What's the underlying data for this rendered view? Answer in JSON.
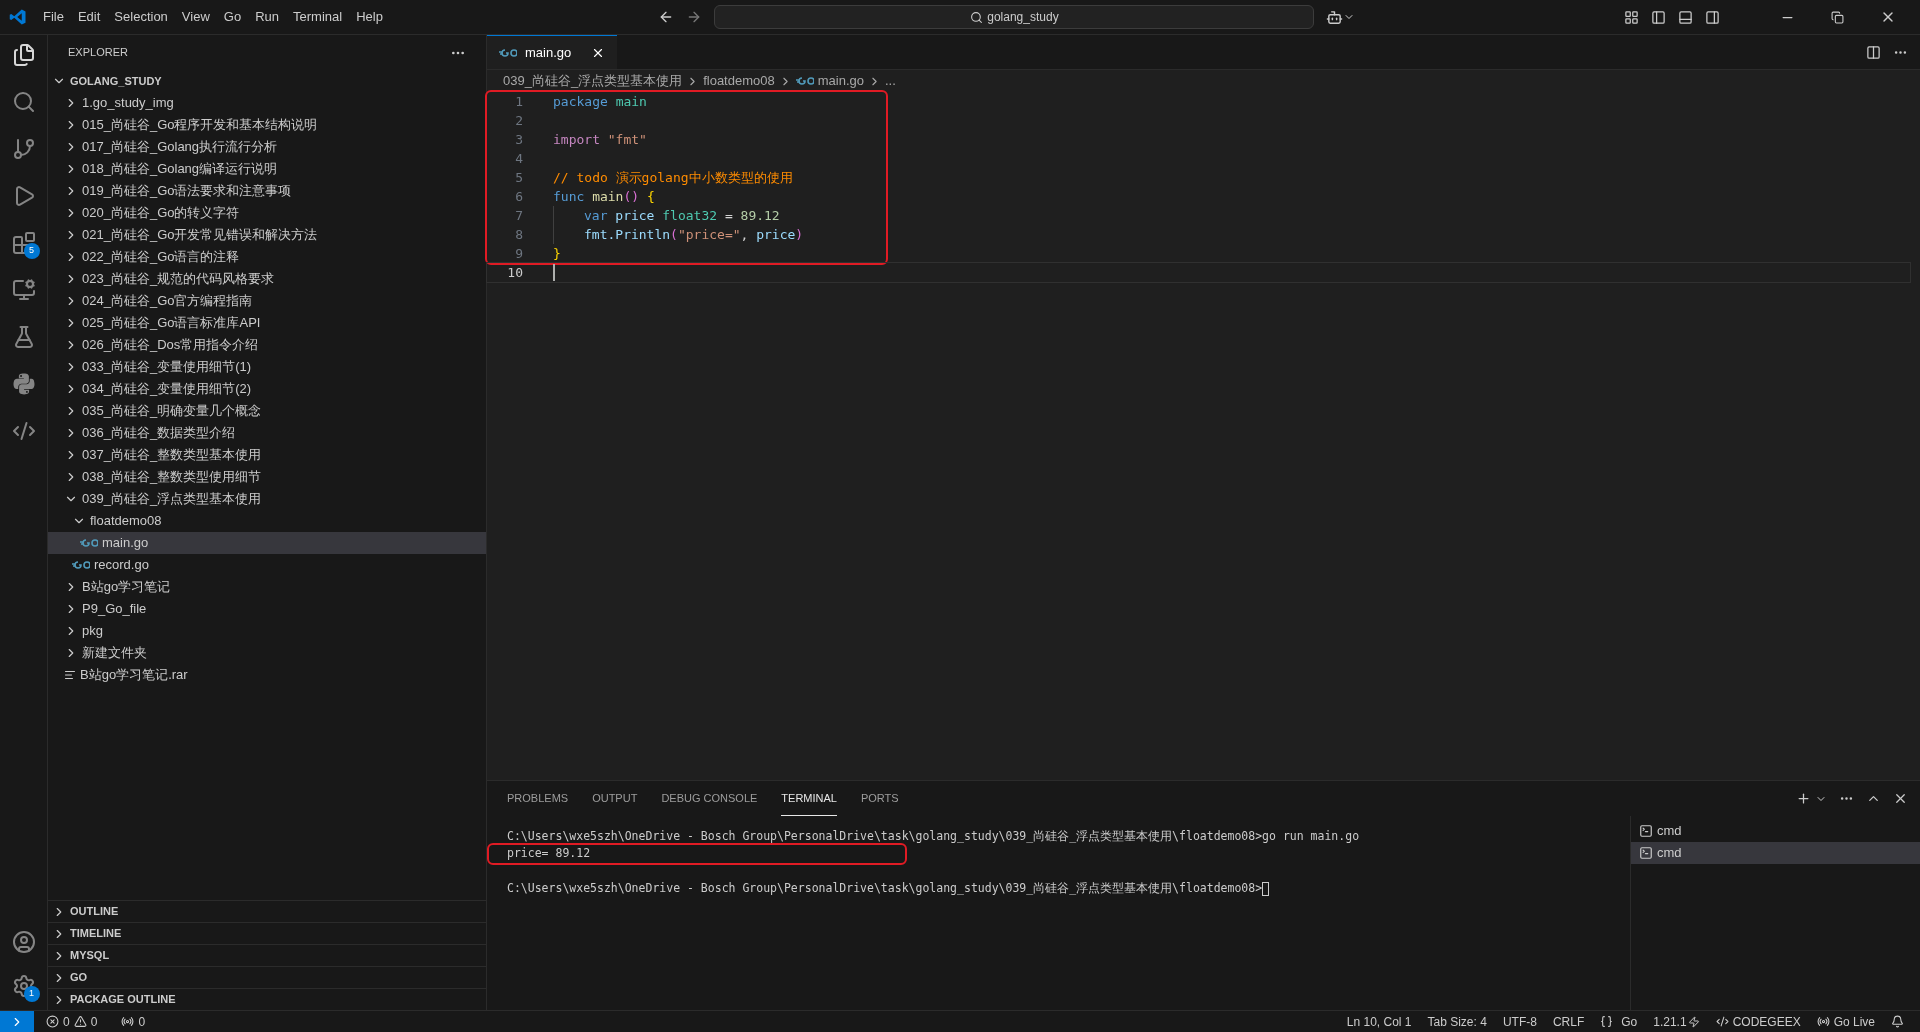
{
  "title_bar": {
    "menu": [
      "File",
      "Edit",
      "Selection",
      "View",
      "Go",
      "Run",
      "Terminal",
      "Help"
    ],
    "search": "golang_study"
  },
  "activity_bar": {
    "extensions_badge": "5",
    "settings_badge": "1"
  },
  "sidebar": {
    "title": "EXPLORER",
    "root": "GOLANG_STUDY",
    "items": [
      {
        "label": "1.go_study_img",
        "kind": "folder",
        "expanded": false,
        "selected": false
      },
      {
        "label": "015_尚硅谷_Go程序开发和基本结构说明",
        "kind": "folder",
        "expanded": false,
        "selected": false
      },
      {
        "label": "017_尚硅谷_Golang执行流行分析",
        "kind": "folder",
        "expanded": false,
        "selected": false
      },
      {
        "label": "018_尚硅谷_Golang编译运行说明",
        "kind": "folder",
        "expanded": false,
        "selected": false
      },
      {
        "label": "019_尚硅谷_Go语法要求和注意事项",
        "kind": "folder",
        "expanded": false,
        "selected": false
      },
      {
        "label": "020_尚硅谷_Go的转义字符",
        "kind": "folder",
        "expanded": false,
        "selected": false
      },
      {
        "label": "021_尚硅谷_Go开发常见错误和解决方法",
        "kind": "folder",
        "expanded": false,
        "selected": false
      },
      {
        "label": "022_尚硅谷_Go语言的注释",
        "kind": "folder",
        "expanded": false,
        "selected": false
      },
      {
        "label": "023_尚硅谷_规范的代码风格要求",
        "kind": "folder",
        "expanded": false,
        "selected": false
      },
      {
        "label": "024_尚硅谷_Go官方编程指南",
        "kind": "folder",
        "expanded": false,
        "selected": false
      },
      {
        "label": "025_尚硅谷_Go语言标准库API",
        "kind": "folder",
        "expanded": false,
        "selected": false
      },
      {
        "label": "026_尚硅谷_Dos常用指令介绍",
        "kind": "folder",
        "expanded": false,
        "selected": false
      },
      {
        "label": "033_尚硅谷_变量使用细节(1)",
        "kind": "folder",
        "expanded": false,
        "selected": false
      },
      {
        "label": "034_尚硅谷_变量使用细节(2)",
        "kind": "folder",
        "expanded": false,
        "selected": false
      },
      {
        "label": "035_尚硅谷_明确变量几个概念",
        "kind": "folder",
        "expanded": false,
        "selected": false
      },
      {
        "label": "036_尚硅谷_数据类型介绍",
        "kind": "folder",
        "expanded": false,
        "selected": false
      },
      {
        "label": "037_尚硅谷_整数类型基本使用",
        "kind": "folder",
        "expanded": false,
        "selected": false
      },
      {
        "label": "038_尚硅谷_整数类型使用细节",
        "kind": "folder",
        "expanded": false,
        "selected": false
      },
      {
        "label": "039_尚硅谷_浮点类型基本使用",
        "kind": "folder",
        "expanded": true,
        "selected": false,
        "children": [
          {
            "label": "floatdemo08",
            "kind": "folder",
            "expanded": true,
            "selected": false,
            "children": [
              {
                "label": "main.go",
                "kind": "go",
                "selected": true
              }
            ]
          },
          {
            "label": "record.go",
            "kind": "go",
            "selected": false
          }
        ]
      },
      {
        "label": "B站go学习笔记",
        "kind": "folder",
        "expanded": false,
        "selected": false
      },
      {
        "label": "P9_Go_file",
        "kind": "folder",
        "expanded": false,
        "selected": false
      },
      {
        "label": "pkg",
        "kind": "folder",
        "expanded": false,
        "selected": false
      },
      {
        "label": "新建文件夹",
        "kind": "folder",
        "expanded": false,
        "selected": false
      },
      {
        "label": "B站go学习笔记.rar",
        "kind": "file",
        "selected": false
      }
    ],
    "sections": [
      "OUTLINE",
      "TIMELINE",
      "MYSQL",
      "GO",
      "PACKAGE OUTLINE"
    ]
  },
  "editor": {
    "tab": "main.go",
    "breadcrumb": [
      "039_尚硅谷_浮点类型基本使用",
      "floatdemo08",
      "main.go",
      "..."
    ],
    "blocks": [
      {
        "highlighted": true,
        "lines": [
          {
            "number": "1",
            "indent": false,
            "current": false,
            "tokens": [
              {
                "text": "package ",
                "kind": "keyword"
              },
              {
                "text": "main",
                "kind": "type"
              }
            ]
          },
          {
            "number": "2",
            "indent": false,
            "current": false
          },
          {
            "number": "3",
            "indent": false,
            "current": false,
            "tokens": [
              {
                "text": "import ",
                "kind": "control"
              },
              {
                "text": "\"fmt\"",
                "kind": "string"
              }
            ]
          },
          {
            "number": "4",
            "indent": false,
            "current": false
          },
          {
            "number": "5",
            "indent": false,
            "current": false,
            "tokens": [
              {
                "text": "// todo 演示golang中小数类型的使用",
                "kind": "comment"
              }
            ]
          },
          {
            "number": "6",
            "indent": false,
            "current": false,
            "tokens": [
              {
                "text": "func ",
                "kind": "keyword"
              },
              {
                "text": "main",
                "kind": "function"
              },
              {
                "text": "() ",
                "kind": "bracket"
              },
              {
                "text": "{",
                "kind": "brace"
              }
            ]
          },
          {
            "number": "7",
            "indent": true,
            "current": false,
            "tokens": [
              {
                "text": "var ",
                "kind": "keyword"
              },
              {
                "text": "price ",
                "kind": "variable"
              },
              {
                "text": "float32",
                "kind": "type"
              },
              {
                "text": " = ",
                "kind": "plain"
              },
              {
                "text": "89.12",
                "kind": "number"
              }
            ]
          },
          {
            "number": "8",
            "indent": true,
            "current": false,
            "tokens": [
              {
                "text": "fmt.Println",
                "kind": "variable"
              },
              {
                "text": "(",
                "kind": "paren"
              },
              {
                "text": "\"price=\"",
                "kind": "string"
              },
              {
                "text": ", ",
                "kind": "plain"
              },
              {
                "text": "price",
                "kind": "variable"
              },
              {
                "text": ")",
                "kind": "paren"
              }
            ]
          },
          {
            "number": "9",
            "indent": false,
            "current": false,
            "tokens": [
              {
                "text": "}",
                "kind": "brace"
              }
            ]
          }
        ]
      },
      {
        "highlighted": false,
        "lines": [
          {
            "number": "10",
            "indent": false,
            "current": true
          }
        ]
      }
    ]
  },
  "panel": {
    "tabs": [
      {
        "label": "PROBLEMS",
        "selected": false
      },
      {
        "label": "OUTPUT",
        "selected": false
      },
      {
        "label": "DEBUG CONSOLE",
        "selected": false
      },
      {
        "label": "TERMINAL",
        "selected": true
      },
      {
        "label": "PORTS",
        "selected": false
      }
    ],
    "terminal": [
      {
        "text": "C:\\Users\\wxe5szh\\OneDrive - Bosch Group\\PersonalDrive\\task\\golang_study\\039_尚硅谷_浮点类型基本使用\\floatdemo08>go run main.go",
        "highlighted": false
      },
      {
        "text": "price= 89.12",
        "highlighted": true
      },
      {
        "highlighted": false
      },
      {
        "text": "C:\\Users\\wxe5szh\\OneDrive - Bosch Group\\PersonalDrive\\task\\golang_study\\039_尚硅谷_浮点类型基本使用\\floatdemo08>",
        "highlighted": false,
        "cursor": true
      }
    ],
    "terminals": [
      {
        "label": "cmd",
        "selected": false
      },
      {
        "label": "cmd",
        "selected": true
      }
    ]
  },
  "status_bar": {
    "errors": "0",
    "warnings": "0",
    "ports": "0",
    "right": [
      {
        "text": "Ln 10, Col 1",
        "kind": "text"
      },
      {
        "text": "Tab Size: 4",
        "kind": "text"
      },
      {
        "text": "UTF-8",
        "kind": "text"
      },
      {
        "text": "CRLF",
        "kind": "text"
      },
      {
        "text": "Go",
        "kind": "language"
      },
      {
        "text": "1.21.1",
        "kind": "version"
      },
      {
        "text": "CODEGEEX",
        "kind": "codegeex"
      },
      {
        "text": "Go Live",
        "kind": "live"
      },
      {
        "kind": "bell"
      }
    ]
  }
}
